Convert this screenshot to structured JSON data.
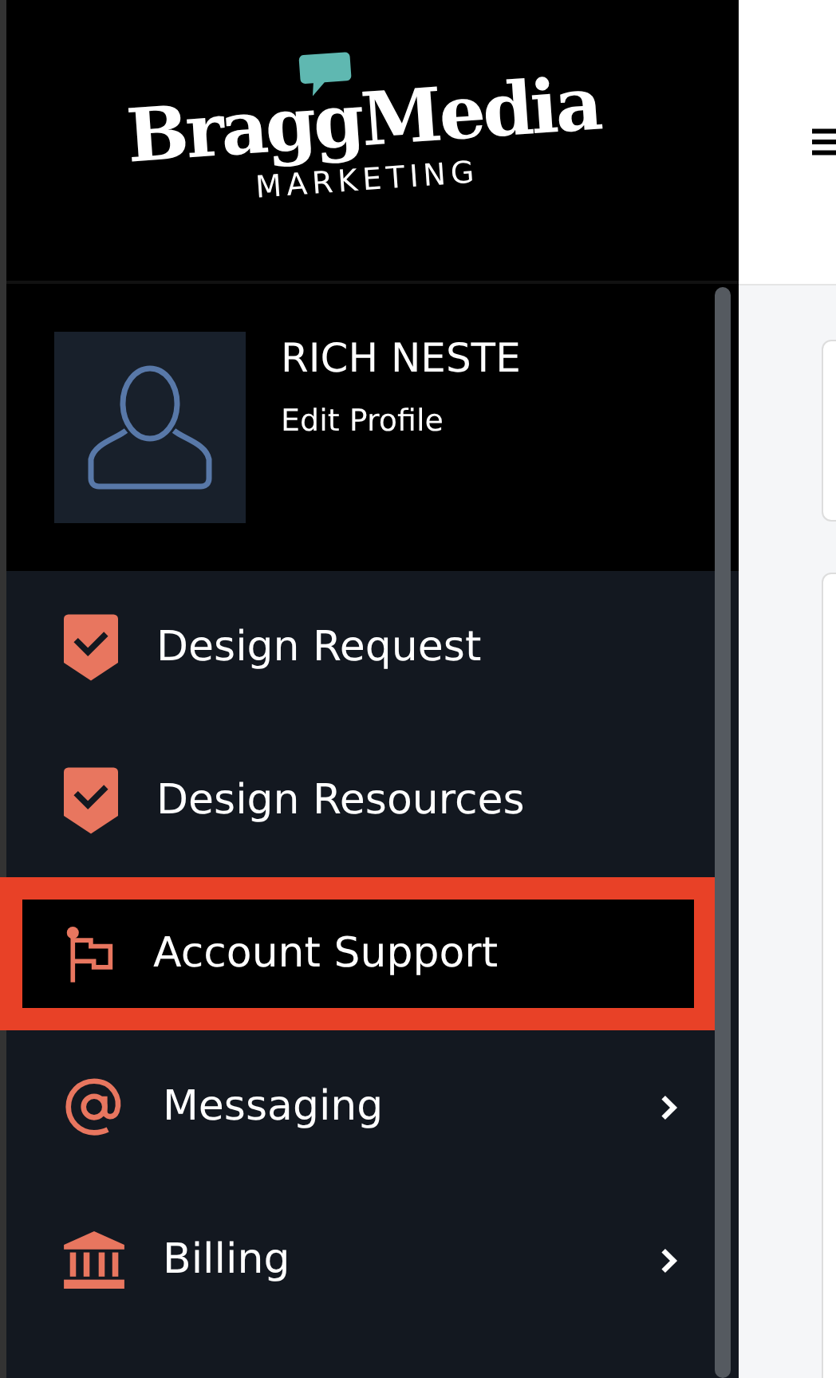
{
  "logo": {
    "name": "BraggMedia",
    "tagline": "MARKETING"
  },
  "profile": {
    "name": "RICH NESTE",
    "link": "Edit Profile"
  },
  "menu": [
    {
      "label": "Design Request",
      "kind": "shield-check",
      "selected": false,
      "has_submenu": false,
      "highlighted": false
    },
    {
      "label": "Design Resources",
      "kind": "shield-check",
      "selected": false,
      "has_submenu": false,
      "highlighted": false
    },
    {
      "label": "Account Support",
      "kind": "flag",
      "selected": true,
      "has_submenu": false,
      "highlighted": true
    },
    {
      "label": "Messaging",
      "kind": "at",
      "selected": false,
      "has_submenu": true,
      "highlighted": false
    },
    {
      "label": "Billing",
      "kind": "bank",
      "selected": false,
      "has_submenu": true,
      "highlighted": false
    }
  ]
}
